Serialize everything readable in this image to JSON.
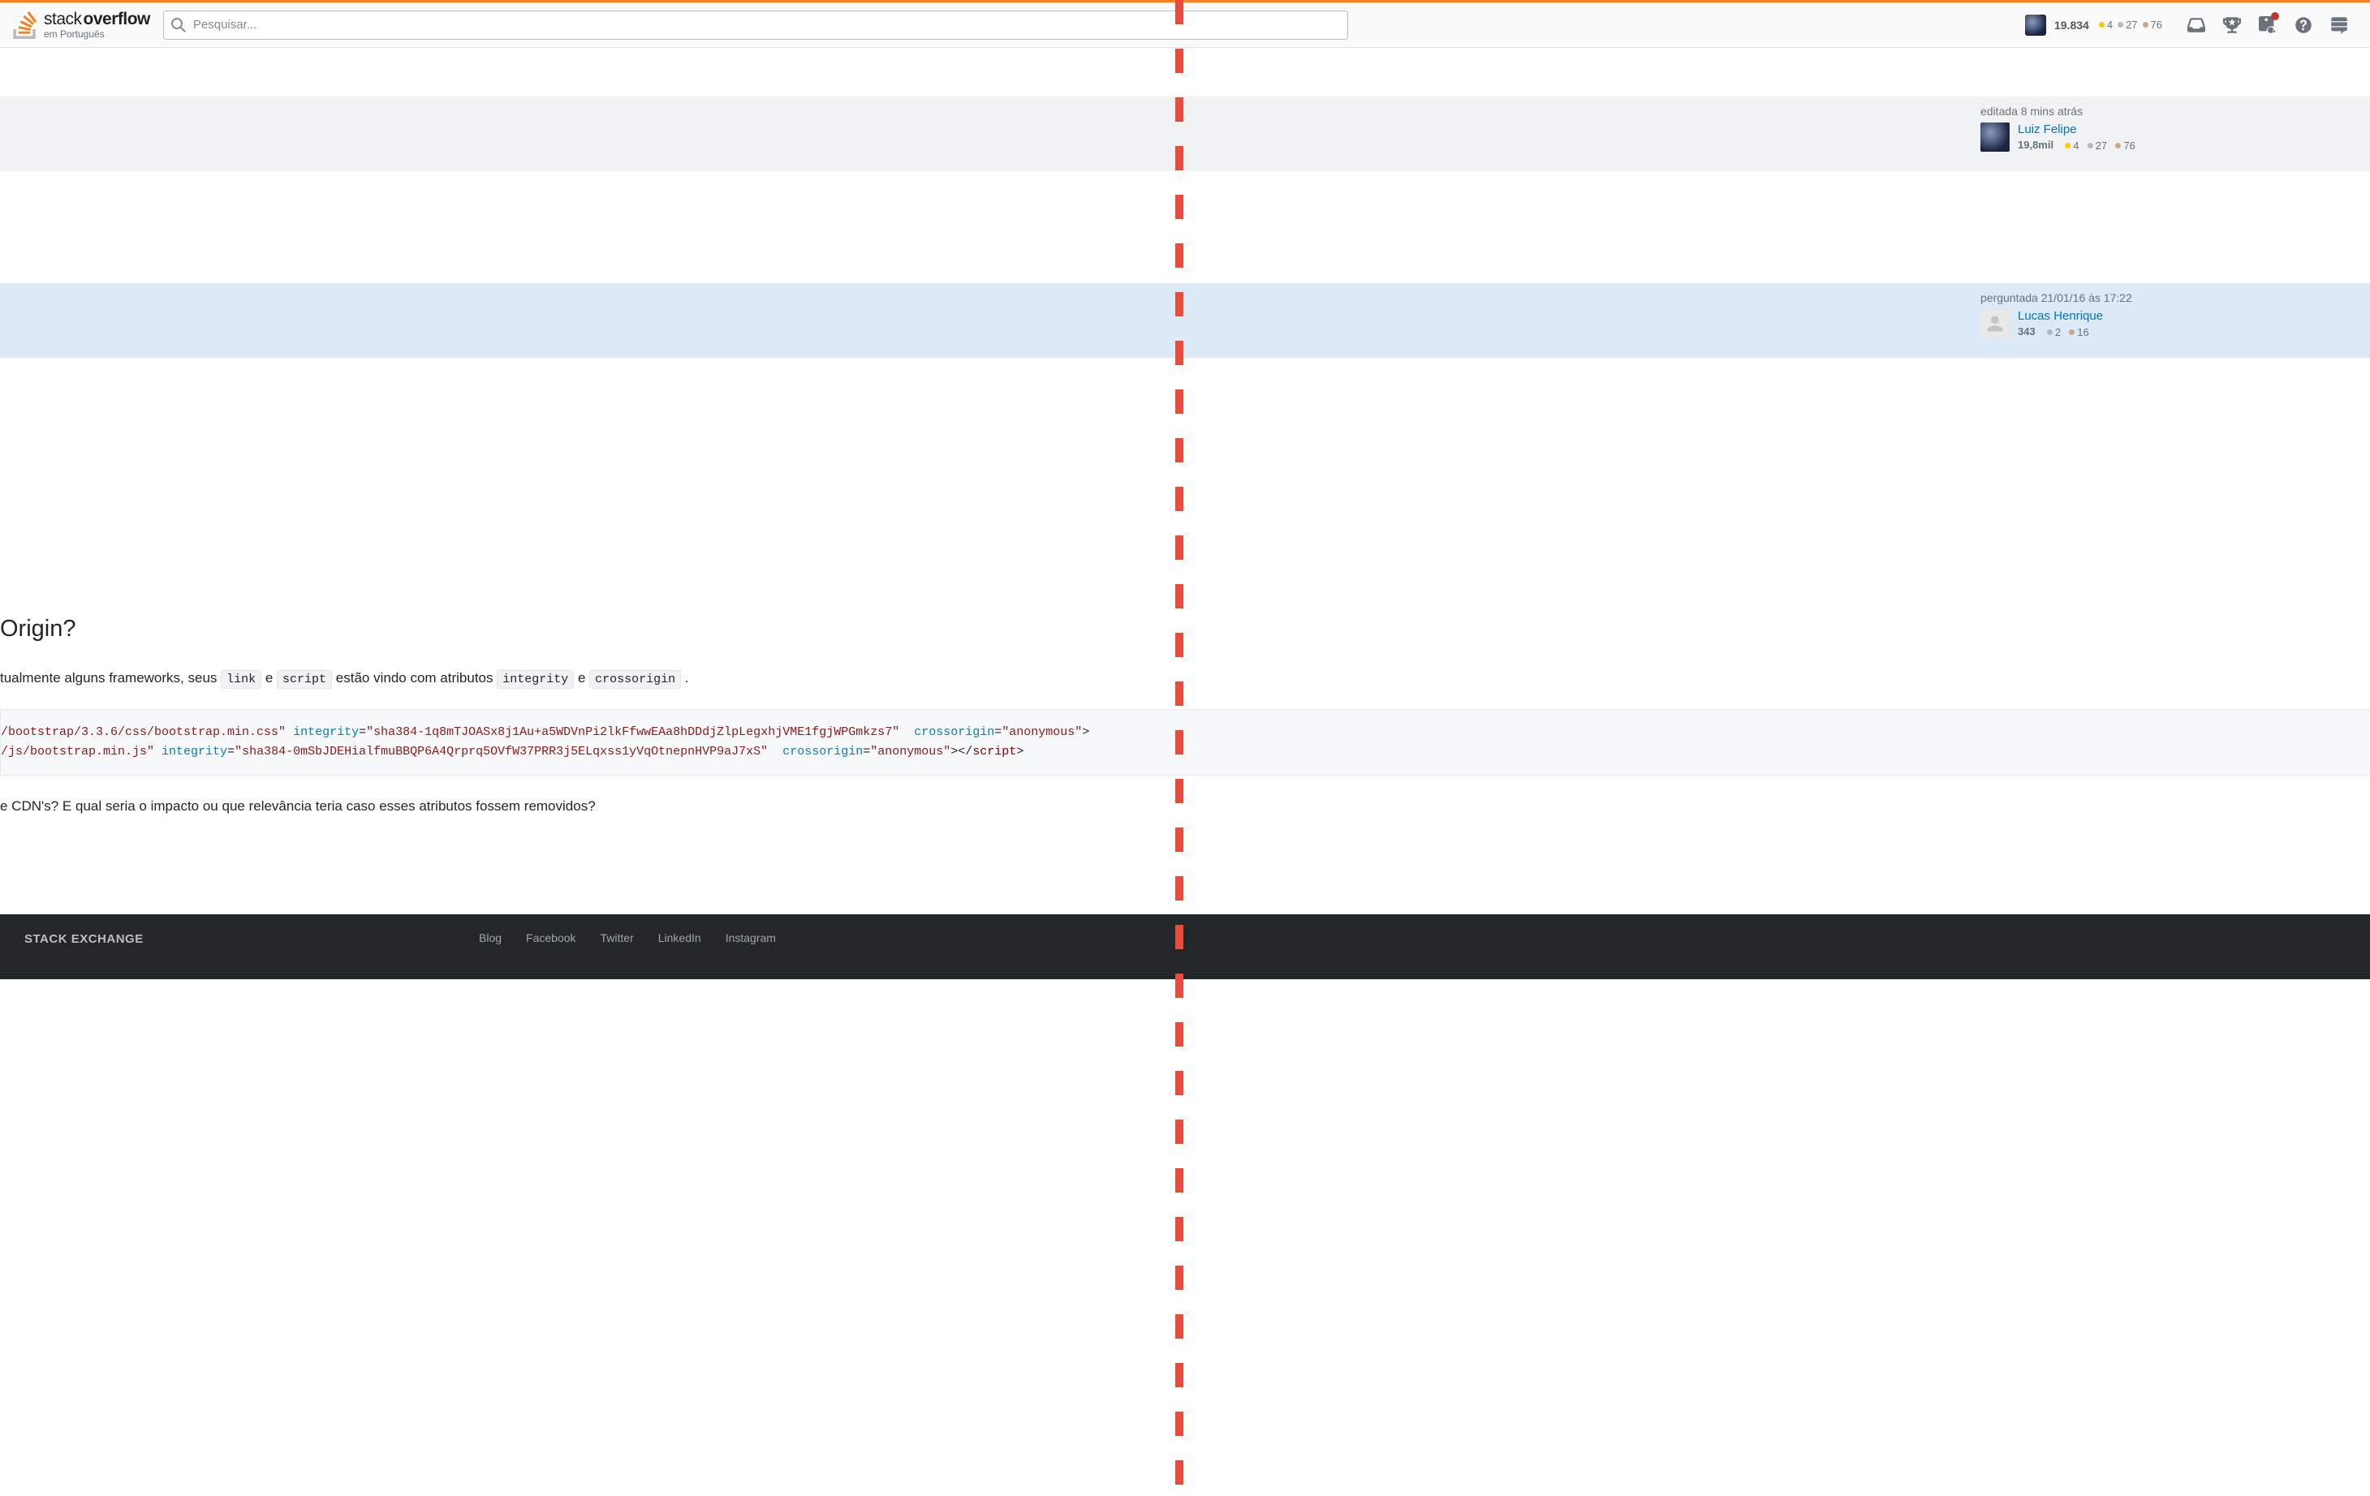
{
  "header": {
    "logo_stack": "stack",
    "logo_overflow": "overflow",
    "logo_sub": "em Português",
    "search_placeholder": "Pesquisar...",
    "reputation": "19.834",
    "gold": "4",
    "silver": "27",
    "bronze": "76"
  },
  "editor_card": {
    "action_prefix": "editada ",
    "action_time": "8 mins atrás",
    "name": "Luiz Felipe",
    "rep": "19,8mil",
    "gold": "4",
    "silver": "27",
    "bronze": "76"
  },
  "asker_card": {
    "action_prefix": "perguntada ",
    "action_time": "21/01/16 às 17:22",
    "name": "Lucas Henrique",
    "rep": "343",
    "silver": "2",
    "bronze": "16"
  },
  "question": {
    "title_fragment": "Origin?",
    "intro_pre": "tualmente alguns frameworks, seus ",
    "c_link": "link",
    "intro_e1": " e ",
    "c_script": "script",
    "intro_post": " estão vindo com atributos ",
    "c_integrity": "integrity",
    "intro_e2": " e ",
    "c_cross": "crossorigin",
    "intro_dot": " .",
    "code_line1_a": "/bootstrap/3.3.6/css/bootstrap.min.css\"",
    "code_line1_b": "integrity",
    "code_line1_c": "=",
    "code_line1_d": "\"sha384-1q8mTJOASx8j1Au+a5WDVnPi2lkFfwwEAa8hDDdjZlpLegxhjVME1fgjWPGmkzs7\"",
    "code_line1_e": "crossorigin",
    "code_line1_f": "=",
    "code_line1_g": "\"anonymous\"",
    "code_line1_h": ">",
    "code_line2_a": "/js/bootstrap.min.js\"",
    "code_line2_b": "integrity",
    "code_line2_c": "=",
    "code_line2_d": "\"sha384-0mSbJDEHialfmuBBQP6A4Qrprq5OVfW37PRR3j5ELqxss1yVqOtnepnHVP9aJ7xS\"",
    "code_line2_e": "crossorigin",
    "code_line2_f": "=",
    "code_line2_g": "\"anonymous\"",
    "code_line2_h": "></",
    "code_line2_i": "script",
    "code_line2_j": ">",
    "text2": "e CDN's? E qual seria o impacto ou que relevância teria caso esses atributos fossem removidos?"
  },
  "footer": {
    "title": "STACK EXCHANGE",
    "links": [
      "Blog",
      "Facebook",
      "Twitter",
      "LinkedIn",
      "Instagram"
    ]
  }
}
